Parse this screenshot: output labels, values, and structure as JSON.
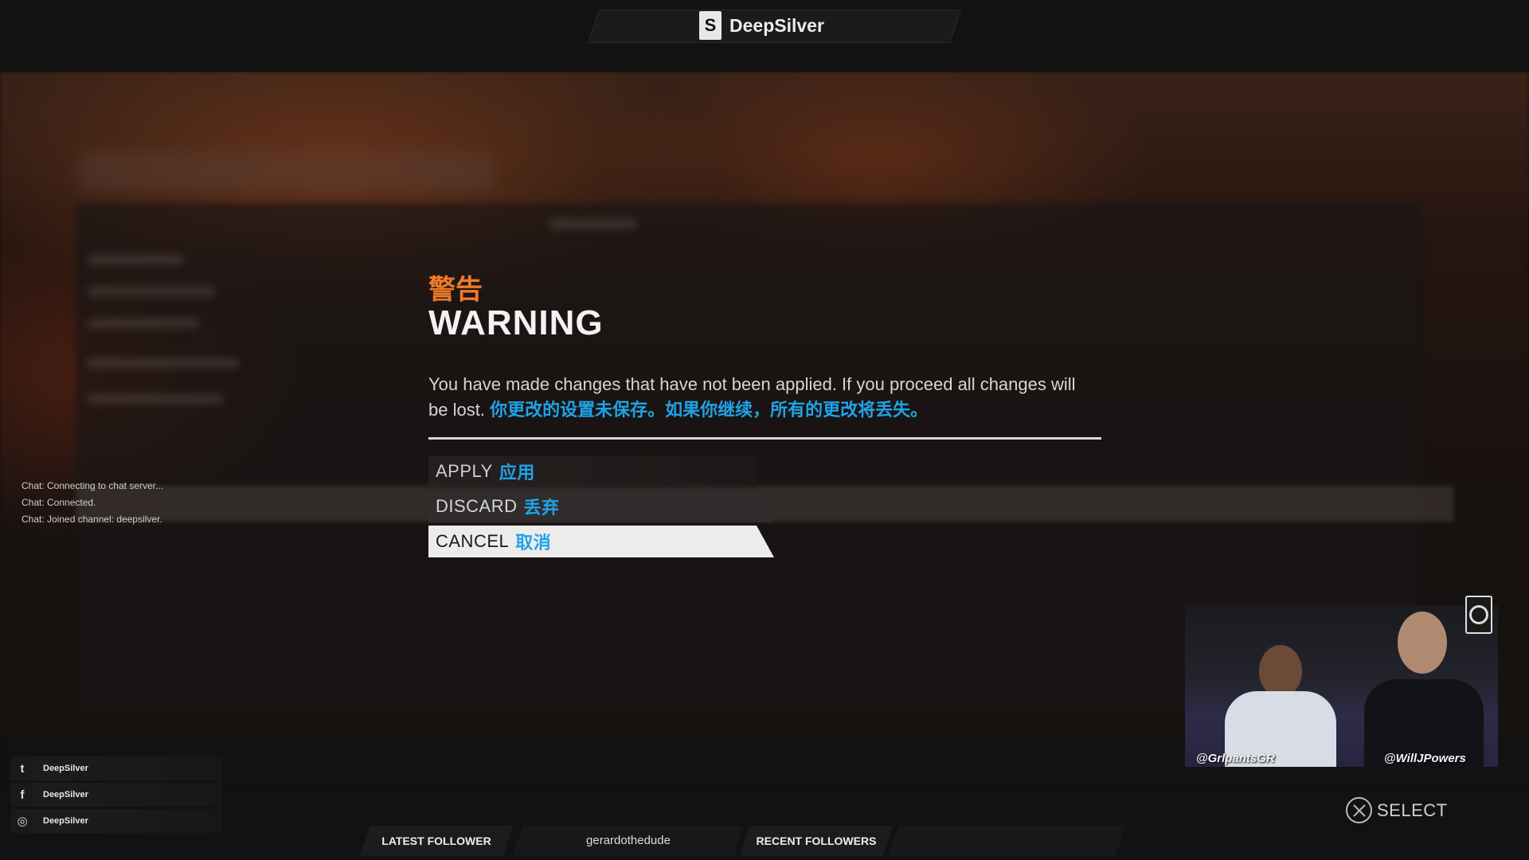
{
  "header": {
    "brand_name": "DeepSilver",
    "brand_logo_glyph": "S",
    "brand_logo": "deep-silver-logo-icon"
  },
  "dialog": {
    "title_cn": "警告",
    "title": "WARNING",
    "message": "You have made changes that have not been applied. If you proceed all changes will be lost.",
    "message_cn": "你更改的设置未保存。如果你继续，所有的更改将丢失。",
    "options": [
      {
        "label": "APPLY",
        "label_cn": "应用",
        "selected": false
      },
      {
        "label": "DISCARD",
        "label_cn": "丢弃",
        "selected": false
      },
      {
        "label": "CANCEL",
        "label_cn": "取消",
        "selected": true
      }
    ],
    "accent_color": "#f07a28",
    "translation_color": "#1fa3e8"
  },
  "chat": {
    "lines": [
      "Chat: Connecting to chat server...",
      "Chat: Connected.",
      "Chat: Joined channel: deepsilver."
    ]
  },
  "socials": [
    {
      "icon": "twitter-icon",
      "glyph": "t",
      "label": "DeepSilver"
    },
    {
      "icon": "facebook-icon",
      "glyph": "f",
      "label": "DeepSilver"
    },
    {
      "icon": "instagram-icon",
      "glyph": "◎",
      "label": "DeepSilver"
    }
  ],
  "footer": {
    "latest_follower_label": "LATEST FOLLOWER",
    "latest_follower_value": "gerardothedude",
    "recent_followers_label": "RECENT FOLLOWERS",
    "recent_followers_value": ""
  },
  "prompt": {
    "icon": "cross-button-icon",
    "label": "SELECT"
  },
  "webcam": {
    "handle_left": "@GrlpantsGR",
    "handle_right": "@WillJPowers"
  }
}
